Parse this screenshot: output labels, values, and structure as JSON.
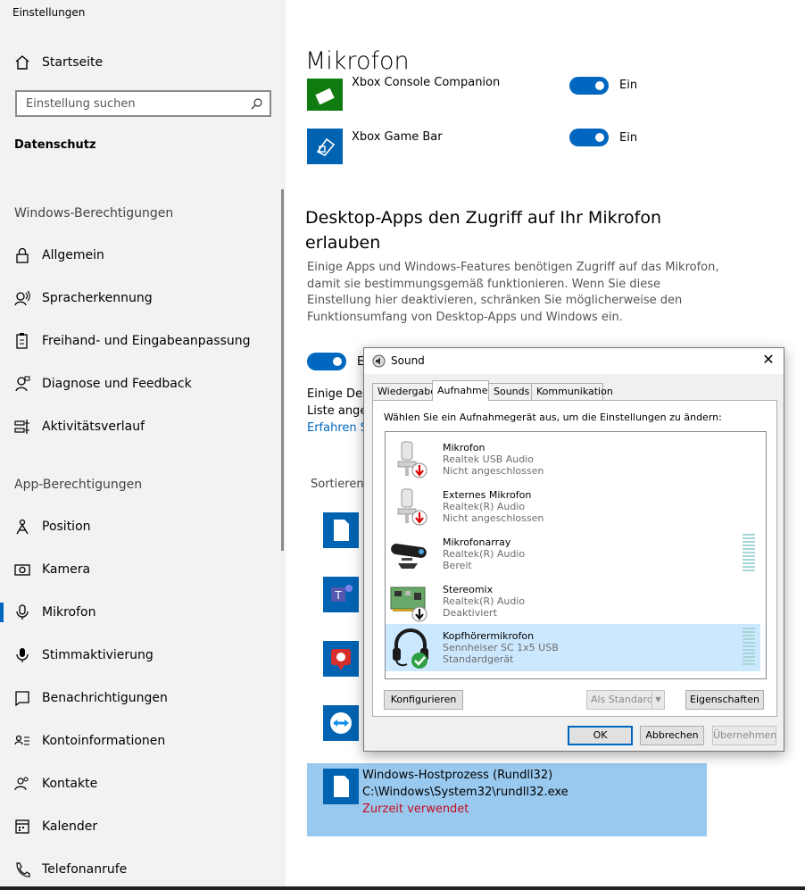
{
  "window_title": "Einstellungen",
  "sidebar": {
    "home_label": "Startseite",
    "search_placeholder": "Einstellung suchen",
    "category": "Datenschutz",
    "section_windows": "Windows-Berechtigungen",
    "windows_items": [
      {
        "label": "Allgemein",
        "icon": "lock-icon"
      },
      {
        "label": "Spracherkennung",
        "icon": "speech-icon"
      },
      {
        "label": "Freihand- und Eingabeanpassung",
        "icon": "clipboard-icon"
      },
      {
        "label": "Diagnose und Feedback",
        "icon": "feedback-icon"
      },
      {
        "label": "Aktivitätsverlauf",
        "icon": "timeline-icon"
      }
    ],
    "section_apps": "App-Berechtigungen",
    "app_items": [
      {
        "label": "Position",
        "icon": "location-icon"
      },
      {
        "label": "Kamera",
        "icon": "camera-icon"
      },
      {
        "label": "Mikrofon",
        "icon": "microphone-icon",
        "active": true
      },
      {
        "label": "Stimmaktivierung",
        "icon": "voice-icon"
      },
      {
        "label": "Benachrichtigungen",
        "icon": "notification-icon"
      },
      {
        "label": "Kontoinformationen",
        "icon": "account-info-icon"
      },
      {
        "label": "Kontakte",
        "icon": "contacts-icon"
      },
      {
        "label": "Kalender",
        "icon": "calendar-icon"
      },
      {
        "label": "Telefonanrufe",
        "icon": "phone-icon"
      }
    ]
  },
  "main": {
    "title": "Mikrofon",
    "apps": [
      {
        "name": "Xbox Console Companion",
        "toggle": "Ein",
        "tile_color": "#107c10"
      },
      {
        "name": "Xbox Game Bar",
        "toggle": "Ein",
        "tile_color": "#0063b1"
      }
    ],
    "desktop_heading": "Desktop-Apps den Zugriff auf Ihr Mikrofon erlauben",
    "desktop_desc": "Einige Apps und Windows-Features benötigen Zugriff auf das Mikrofon, damit sie bestimmungsgemäß funktionieren. Wenn Sie diese Einstellung hier deaktivieren, schränken Sie möglicherweise den Funktionsumfang von Desktop-Apps und Windows ein.",
    "toggle_fragment": "E",
    "text_fragment_1": "Einige Des",
    "text_fragment_2": "Liste ange",
    "link_fragment": "Erfahren S",
    "sort_fragment": "Sortieren",
    "highlight": {
      "name": "Windows-Hostprozess (Rundll32)",
      "path": "C:\\Windows\\System32\\rundll32.exe",
      "status": "Zurzeit verwendet"
    }
  },
  "dialog": {
    "title": "Sound",
    "tabs": [
      "Wiedergabe",
      "Aufnahme",
      "Sounds",
      "Kommunikation"
    ],
    "active_tab": "Aufnahme",
    "instruction": "Wählen Sie ein Aufnahmegerät aus, um die Einstellungen zu ändern:",
    "devices": [
      {
        "name": "Mikrofon",
        "driver": "Realtek USB Audio",
        "status": "Nicht angeschlossen"
      },
      {
        "name": "Externes Mikrofon",
        "driver": "Realtek(R) Audio",
        "status": "Nicht angeschlossen"
      },
      {
        "name": "Mikrofonarray",
        "driver": "Realtek(R) Audio",
        "status": "Bereit"
      },
      {
        "name": "Stereomix",
        "driver": "Realtek(R) Audio",
        "status": "Deaktiviert"
      },
      {
        "name": "Kopfhörermikrofon",
        "driver": "Sennheiser SC 1x5 USB",
        "status": "Standardgerät"
      }
    ],
    "btn_configure": "Konfigurieren",
    "btn_default": "Als Standard",
    "btn_properties": "Eigenschaften",
    "btn_ok": "OK",
    "btn_cancel": "Abbrechen",
    "btn_apply": "Übernehmen"
  }
}
